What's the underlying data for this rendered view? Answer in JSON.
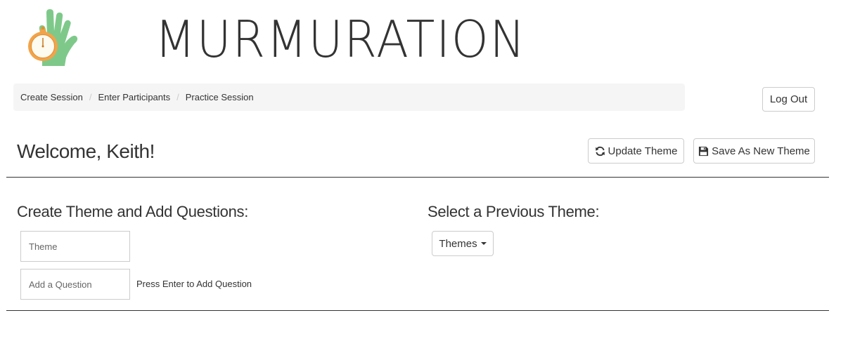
{
  "header": {
    "brand": "MURMURATION",
    "logo_icon": "hand-stopwatch-icon"
  },
  "breadcrumb": {
    "items": [
      "Create Session",
      "Enter Participants",
      "Practice Session"
    ],
    "separator": "/"
  },
  "account": {
    "logout_label": "Log Out"
  },
  "page": {
    "welcome": "Welcome, Keith!"
  },
  "toolbar": {
    "update_theme_label": "Update Theme",
    "update_theme_icon": "refresh-icon",
    "save_new_theme_label": "Save As New Theme",
    "save_new_theme_icon": "floppy-disk-icon"
  },
  "create_section": {
    "heading": "Create Theme and Add Questions:",
    "theme_input": {
      "placeholder": "Theme",
      "value": ""
    },
    "question_input": {
      "placeholder": "Add a Question",
      "value": ""
    },
    "hint": "Press Enter to Add Question"
  },
  "select_section": {
    "heading": "Select a Previous Theme:",
    "dropdown_label": "Themes"
  },
  "colors": {
    "text": "#333333",
    "hand_green": "#7ec98a",
    "stopwatch_orange": "#f2a34a",
    "breadcrumb_bg": "#f5f5f5",
    "border": "#cccccc"
  }
}
